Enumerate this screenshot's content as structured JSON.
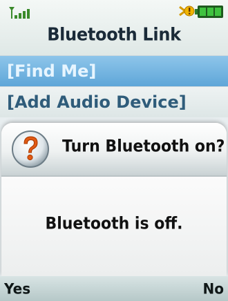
{
  "status_bar": {
    "signal_icon": "signal-strength-icon",
    "battery_icon": "battery-icon",
    "notify_icon": "bluetooth-alert-icon",
    "colors": {
      "signal": "#3a8a2a",
      "battery": "#2a9a2a",
      "notify": "#e6a800"
    }
  },
  "screen": {
    "title": "Bluetooth Link"
  },
  "menu": {
    "items": [
      {
        "label": "[Find Me]",
        "selected": true
      },
      {
        "label": "[Add Audio Device]",
        "selected": false
      }
    ],
    "selected_color": "#6fb2e0"
  },
  "dialog": {
    "icon": "question-icon",
    "title": "Turn Bluetooth on?",
    "message": "Bluetooth is off."
  },
  "softkeys": {
    "left_label": "Yes",
    "right_label": "No"
  }
}
